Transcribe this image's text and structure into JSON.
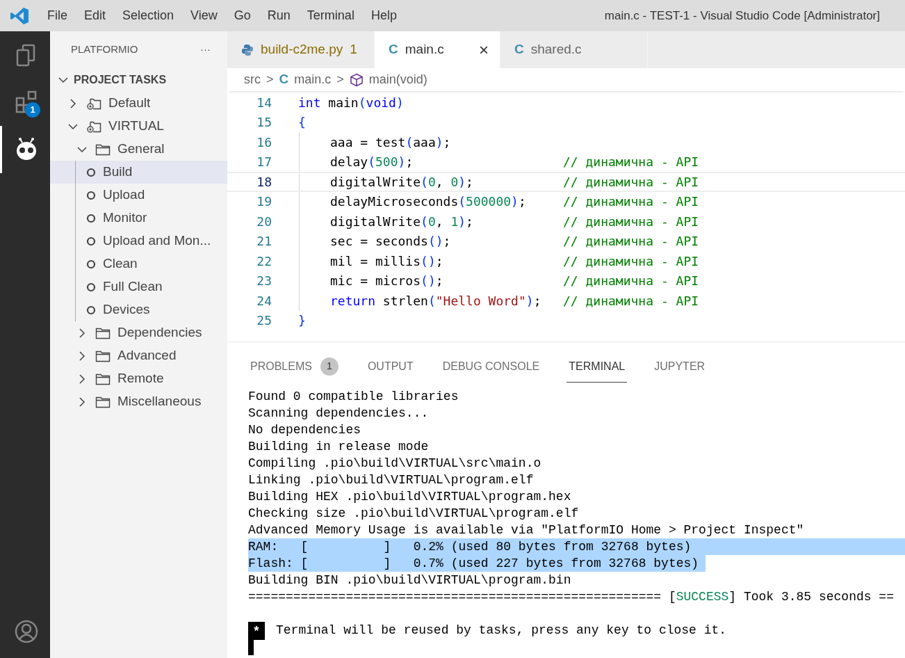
{
  "window": {
    "title": "main.c - TEST-1 - Visual Studio Code [Administrator]"
  },
  "menu": [
    "File",
    "Edit",
    "Selection",
    "View",
    "Go",
    "Run",
    "Terminal",
    "Help"
  ],
  "activity_bar": [
    {
      "kind": "explorer",
      "selected": false
    },
    {
      "kind": "extensions",
      "selected": false,
      "badge": "1"
    },
    {
      "kind": "platformio",
      "selected": true
    },
    {
      "kind": "account",
      "selected": false
    }
  ],
  "sidebar": {
    "title": "PLATFORMIO",
    "more": "···",
    "section": {
      "label": "PROJECT TASKS",
      "expanded": true
    },
    "items": [
      {
        "label": "Default",
        "kind": "env",
        "expanded": false,
        "selected": false
      },
      {
        "label": "VIRTUAL",
        "kind": "env",
        "expanded": true,
        "selected": false,
        "children": [
          {
            "label": "General",
            "kind": "folder",
            "expanded": true,
            "selected": false,
            "children": [
              {
                "label": "Build",
                "kind": "task",
                "selected": true
              },
              {
                "label": "Upload",
                "kind": "task",
                "selected": false
              },
              {
                "label": "Monitor",
                "kind": "task",
                "selected": false
              },
              {
                "label": "Upload and Mon...",
                "kind": "task",
                "selected": false
              },
              {
                "label": "Clean",
                "kind": "task",
                "selected": false
              },
              {
                "label": "Full Clean",
                "kind": "task",
                "selected": false
              },
              {
                "label": "Devices",
                "kind": "task",
                "selected": false
              }
            ]
          },
          {
            "label": "Dependencies",
            "kind": "folder",
            "expanded": false,
            "selected": false
          },
          {
            "label": "Advanced",
            "kind": "folder",
            "expanded": false,
            "selected": false
          },
          {
            "label": "Remote",
            "kind": "folder",
            "expanded": false,
            "selected": false
          },
          {
            "label": "Miscellaneous",
            "kind": "folder",
            "expanded": false,
            "selected": false
          }
        ]
      }
    ]
  },
  "tabs": [
    {
      "label": "build-c2me.py",
      "kind": "python",
      "count": "1",
      "selected": false
    },
    {
      "label": "main.c",
      "kind": "c",
      "icon": "C",
      "close": "×",
      "selected": true
    },
    {
      "label": "shared.c",
      "kind": "c",
      "icon": "C",
      "selected": false
    }
  ],
  "breadcrumbs": {
    "folder": "src",
    "sep": ">",
    "file_icon": "C",
    "file": "main.c",
    "symbol": "main(void)"
  },
  "code": [
    {
      "number": "14",
      "current": false,
      "indent": false,
      "tokens": [
        {
          "t": "int",
          "kind": "kw"
        },
        {
          "t": " main",
          "kind": "pl"
        },
        {
          "t": "(",
          "kind": "br"
        },
        {
          "t": "void",
          "kind": "kw"
        },
        {
          "t": ")",
          "kind": "br"
        }
      ]
    },
    {
      "number": "15",
      "current": false,
      "indent": false,
      "tokens": [
        {
          "t": "{",
          "kind": "br"
        }
      ]
    },
    {
      "number": "16",
      "current": false,
      "indent": true,
      "tokens": [
        {
          "t": "aaa = test",
          "kind": "pl"
        },
        {
          "t": "(",
          "kind": "br"
        },
        {
          "t": "aaa",
          "kind": "pl"
        },
        {
          "t": ")",
          "kind": "br"
        },
        {
          "t": ";",
          "kind": "pl"
        }
      ]
    },
    {
      "number": "17",
      "current": false,
      "indent": true,
      "tokens": [
        {
          "t": "delay",
          "kind": "pl"
        },
        {
          "t": "(",
          "kind": "br"
        },
        {
          "t": "500",
          "kind": "num"
        },
        {
          "t": ")",
          "kind": "br"
        },
        {
          "t": ";",
          "kind": "pl"
        }
      ],
      "comment": "// динамична - API"
    },
    {
      "number": "18",
      "current": true,
      "indent": true,
      "tokens": [
        {
          "t": "digitalWrite",
          "kind": "pl"
        },
        {
          "t": "(",
          "kind": "br"
        },
        {
          "t": "0",
          "kind": "num"
        },
        {
          "t": ", ",
          "kind": "pl"
        },
        {
          "t": "0",
          "kind": "num"
        },
        {
          "t": ")",
          "kind": "br"
        },
        {
          "t": ";",
          "kind": "pl"
        }
      ],
      "comment": "// динамична - API"
    },
    {
      "number": "19",
      "current": false,
      "indent": true,
      "tokens": [
        {
          "t": "delayMicroseconds",
          "kind": "pl"
        },
        {
          "t": "(",
          "kind": "br"
        },
        {
          "t": "500000",
          "kind": "num"
        },
        {
          "t": ")",
          "kind": "br"
        },
        {
          "t": ";",
          "kind": "pl"
        }
      ],
      "comment": "// динамична - API"
    },
    {
      "number": "20",
      "current": false,
      "indent": true,
      "tokens": [
        {
          "t": "digitalWrite",
          "kind": "pl"
        },
        {
          "t": "(",
          "kind": "br"
        },
        {
          "t": "0",
          "kind": "num"
        },
        {
          "t": ", ",
          "kind": "pl"
        },
        {
          "t": "1",
          "kind": "num"
        },
        {
          "t": ")",
          "kind": "br"
        },
        {
          "t": ";",
          "kind": "pl"
        }
      ],
      "comment": "// динамична - API"
    },
    {
      "number": "21",
      "current": false,
      "indent": true,
      "tokens": [
        {
          "t": "sec = seconds",
          "kind": "pl"
        },
        {
          "t": "()",
          "kind": "br"
        },
        {
          "t": ";",
          "kind": "pl"
        }
      ],
      "comment": "// динамична - API"
    },
    {
      "number": "22",
      "current": false,
      "indent": true,
      "tokens": [
        {
          "t": "mil = millis",
          "kind": "pl"
        },
        {
          "t": "()",
          "kind": "br"
        },
        {
          "t": ";",
          "kind": "pl"
        }
      ],
      "comment": "// динамична - API"
    },
    {
      "number": "23",
      "current": false,
      "indent": true,
      "tokens": [
        {
          "t": "mic = micros",
          "kind": "pl"
        },
        {
          "t": "()",
          "kind": "br"
        },
        {
          "t": ";",
          "kind": "pl"
        }
      ],
      "comment": "// динамична - API"
    },
    {
      "number": "24",
      "current": false,
      "indent": true,
      "tokens": [
        {
          "t": "return",
          "kind": "kw"
        },
        {
          "t": " strlen",
          "kind": "pl"
        },
        {
          "t": "(",
          "kind": "br"
        },
        {
          "t": "\"Hello Word\"",
          "kind": "str"
        },
        {
          "t": ")",
          "kind": "br"
        },
        {
          "t": ";",
          "kind": "pl"
        }
      ],
      "comment": "// динамична - API"
    },
    {
      "number": "25",
      "current": false,
      "indent": false,
      "tokens": [
        {
          "t": "}",
          "kind": "br"
        }
      ]
    }
  ],
  "panel": {
    "tabs": [
      {
        "label": "PROBLEMS",
        "badge": "1",
        "selected": false
      },
      {
        "label": "OUTPUT",
        "selected": false
      },
      {
        "label": "DEBUG CONSOLE",
        "selected": false
      },
      {
        "label": "TERMINAL",
        "selected": true
      },
      {
        "label": "JUPYTER",
        "selected": false
      }
    ],
    "terminal": [
      {
        "kind": "text",
        "text": "Found 0 compatible libraries",
        "selected": false
      },
      {
        "kind": "text",
        "text": "Scanning dependencies...",
        "selected": false
      },
      {
        "kind": "text",
        "text": "No dependencies",
        "selected": false
      },
      {
        "kind": "text",
        "text": "Building in release mode",
        "selected": false
      },
      {
        "kind": "text",
        "text": "Compiling .pio\\build\\VIRTUAL\\src\\main.o",
        "selected": false
      },
      {
        "kind": "text",
        "text": "Linking .pio\\build\\VIRTUAL\\program.elf",
        "selected": false
      },
      {
        "kind": "text",
        "text": "Building HEX .pio\\build\\VIRTUAL\\program.hex",
        "selected": false
      },
      {
        "kind": "text",
        "text": "Checking size .pio\\build\\VIRTUAL\\program.elf",
        "selected": false
      },
      {
        "kind": "text",
        "text": "Advanced Memory Usage is available via \"PlatformIO Home > Project Inspect\"",
        "selected": false
      },
      {
        "kind": "text",
        "text": "RAM:   [          ]   0.2% (used 80 bytes from 32768 bytes)",
        "selected": true
      },
      {
        "kind": "text",
        "text": "Flash: [          ]   0.7% (used 227 bytes from 32768 bytes)",
        "selected": true
      },
      {
        "kind": "text",
        "text": "Building BIN .pio\\build\\VIRTUAL\\program.bin",
        "selected": false
      },
      {
        "kind": "result",
        "before": "======================================================= [",
        "status": "SUCCESS",
        "after": "] Took 3.85 seconds ==",
        "selected": false
      },
      {
        "kind": "notice",
        "marker": "*",
        "text": "Terminal will be reused by tasks, press any key to close it."
      }
    ]
  }
}
